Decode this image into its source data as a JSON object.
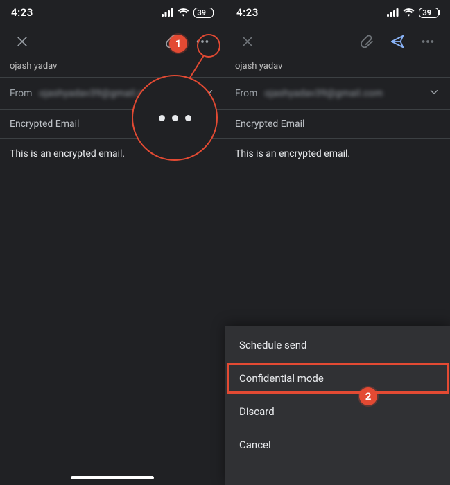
{
  "status": {
    "time": "4:23",
    "battery": "39"
  },
  "compose": {
    "to_name": "ojash yadav",
    "from_label": "From",
    "from_email": "ojashyadav39@gmail.com",
    "subject": "Encrypted Email",
    "body": "This is an encrypted email."
  },
  "sheet": {
    "schedule": "Schedule send",
    "confidential": "Confidential mode",
    "discard": "Discard",
    "cancel": "Cancel"
  },
  "annotations": {
    "step1": "1",
    "step2": "2"
  }
}
